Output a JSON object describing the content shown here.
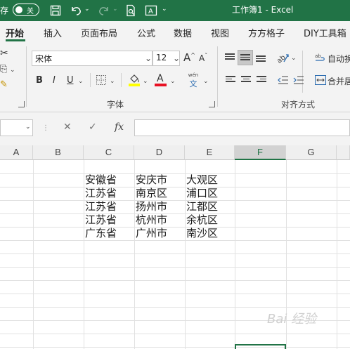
{
  "titlebar": {
    "autosave_label": "存",
    "toggle_state": "关",
    "title": "工作簿1 - Excel"
  },
  "tabs": [
    "开始",
    "插入",
    "页面布局",
    "公式",
    "数据",
    "视图",
    "方方格子",
    "DIY工具箱"
  ],
  "ribbon": {
    "font_name": "宋体",
    "font_size": "12",
    "grow_font": "A",
    "shrink_font": "A",
    "bold": "B",
    "italic": "I",
    "underline": "U",
    "font_color_letter": "A",
    "phonetic_top": "wén",
    "phonetic_bottom": "文",
    "wrap_text": "自动换",
    "merge_center": "合并居",
    "group_font": "字体",
    "group_alignment": "对齐方式"
  },
  "formula_bar": {
    "cancel": "✕",
    "enter": "✓",
    "fx": "fx",
    "name_box": "",
    "formula": ""
  },
  "grid": {
    "columns": [
      "A",
      "B",
      "C",
      "D",
      "E",
      "F",
      "G"
    ],
    "selected_column": "F",
    "rows": [
      [
        "",
        "",
        "安徽省",
        "安庆市",
        "大观区",
        "",
        ""
      ],
      [
        "",
        "",
        "江苏省",
        "南京区",
        "浦口区",
        "",
        ""
      ],
      [
        "",
        "",
        "江苏省",
        "扬州市",
        "江都区",
        "",
        ""
      ],
      [
        "",
        "",
        "江苏省",
        "杭州市",
        "余杭区",
        "",
        ""
      ],
      [
        "",
        "",
        "广东省",
        "广州市",
        "南沙区",
        "",
        ""
      ]
    ]
  },
  "watermark": "Bai 经验",
  "colors": {
    "accent": "#217346",
    "ribbon_bg": "#f3f3f3",
    "font_color_bar": "#e81123",
    "highlight_bar": "#ffff00"
  },
  "icons": [
    "save-icon",
    "undo-icon",
    "redo-icon",
    "print-preview-icon",
    "text-box-icon",
    "borders-icon",
    "fill-color-icon",
    "font-color-icon",
    "phonetic-icon",
    "align-top-icon",
    "align-middle-icon",
    "align-bottom-icon",
    "orientation-icon",
    "align-left-icon",
    "align-center-icon",
    "align-right-icon",
    "decrease-indent-icon",
    "increase-indent-icon",
    "wrap-text-icon",
    "merge-icon",
    "fx-icon"
  ]
}
